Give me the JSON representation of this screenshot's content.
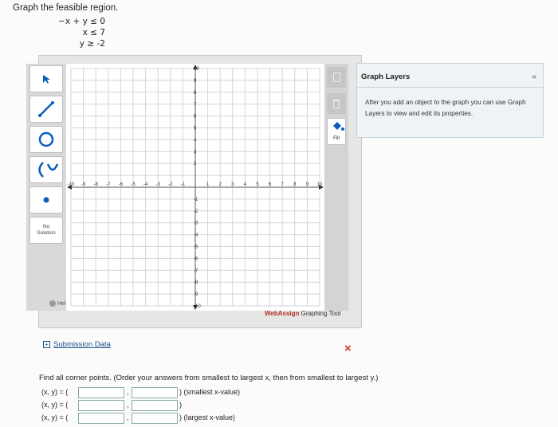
{
  "prompt": {
    "title": "Graph the feasible region."
  },
  "inequalities": [
    {
      "lhs": "−x + y",
      "op": "≤",
      "rhs": "0"
    },
    {
      "lhs": "x",
      "op": "≤",
      "rhs": "7"
    },
    {
      "lhs": "y",
      "op": "≥",
      "rhs": "-2"
    }
  ],
  "toolbar": {
    "no_solution_line1": "No",
    "no_solution_line2": "Solution",
    "help": "Help",
    "fill_label": "Fill"
  },
  "graph": {
    "x_ticks": [
      "-10",
      "-9",
      "-8",
      "-7",
      "-6",
      "-5",
      "-4",
      "-3",
      "-2",
      "-1",
      "1",
      "2",
      "3",
      "4",
      "5",
      "6",
      "7",
      "8",
      "9",
      "10"
    ],
    "y_ticks": [
      "10",
      "9",
      "8",
      "7",
      "6",
      "5",
      "4",
      "3",
      "2",
      "-1",
      "-2",
      "-3",
      "-4",
      "-5",
      "-6",
      "-7",
      "-8",
      "-9",
      "-10"
    ],
    "xlim": [
      -10,
      10
    ],
    "ylim": [
      -10,
      10
    ],
    "grid": true,
    "brand_accent": "WebAssign",
    "brand_rest": "Graphing Tool"
  },
  "layers_panel": {
    "title": "Graph Layers",
    "collapse": "«",
    "text": "After you add an object to the graph you can use Graph Layers to view and edit its properties."
  },
  "submission": {
    "label": "Submission Data",
    "toggle": "+"
  },
  "status": {
    "incorrect": "×"
  },
  "corners": {
    "instruction": "Find all corner points. (Order your answers from smallest to largest x, then from smallest to largest y.)",
    "row_label": "(x, y) = (",
    "comma": ",",
    "rows": [
      {
        "tail": ") (smallest x-value)",
        "x": "",
        "y": ""
      },
      {
        "tail": ")",
        "x": "",
        "y": ""
      },
      {
        "tail": ") (largest x-value)",
        "x": "",
        "y": ""
      }
    ]
  },
  "colors": {
    "accent": "#0a5ebd",
    "error": "#d23a2a",
    "grid": "#cfd6dc",
    "brand": "#b0322b"
  }
}
